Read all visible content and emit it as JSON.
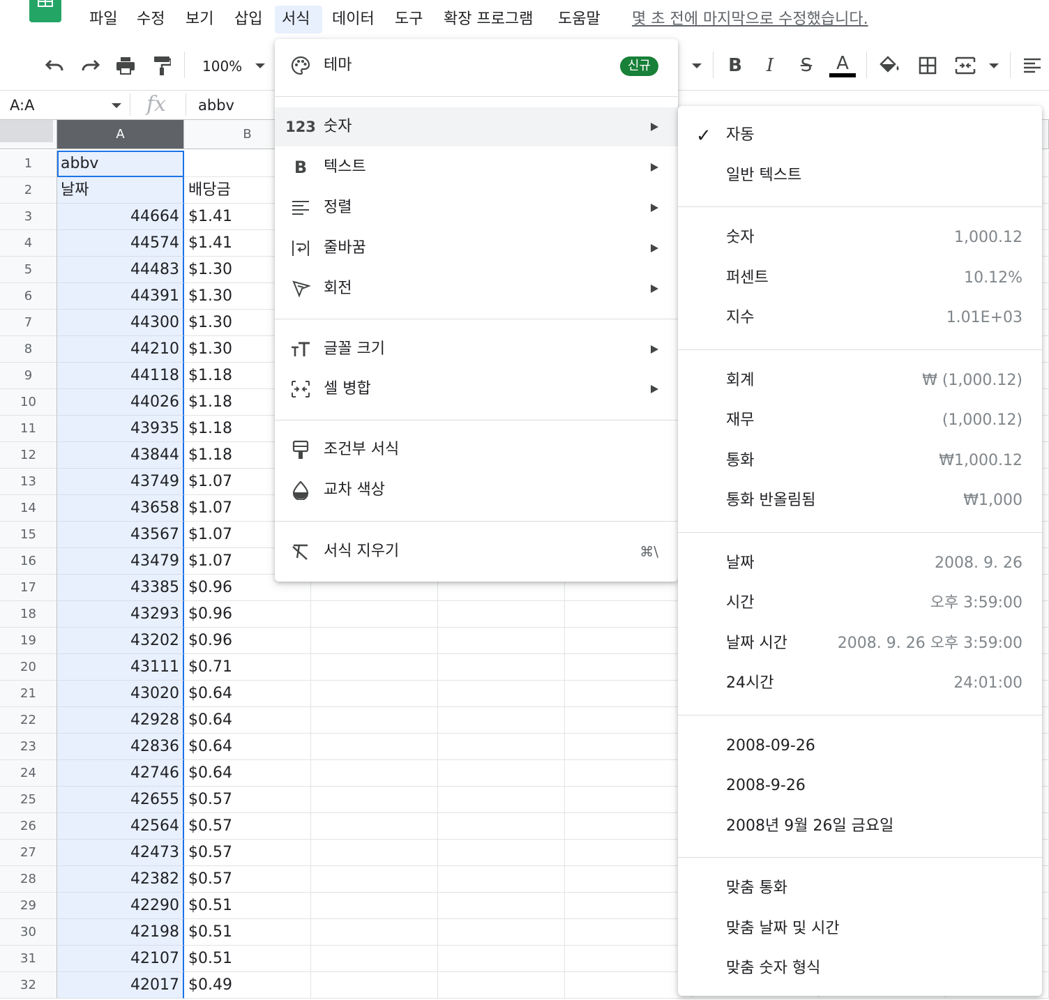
{
  "menubar": {
    "items": [
      "파일",
      "수정",
      "보기",
      "삽입",
      "서식",
      "데이터",
      "도구",
      "확장 프로그램",
      "도움말"
    ],
    "active": "서식",
    "last_edit": "몇 초 전에 마지막으로 수정했습니다."
  },
  "toolbar": {
    "zoom": "100%",
    "icons": [
      "undo-icon",
      "redo-icon",
      "print-icon",
      "paint-format-icon",
      "zoom-select",
      "bold-icon",
      "italic-icon",
      "strikethrough-icon",
      "text-color-icon",
      "fill-color-icon",
      "borders-icon",
      "merge-cells-icon",
      "horizontal-align-icon"
    ],
    "text_color": "#000000"
  },
  "formula_bar": {
    "name_box": "A:A",
    "fx": "fx",
    "value": "abbv"
  },
  "sheet": {
    "columns": [
      "A",
      "B"
    ],
    "selected_column": "A",
    "rows": [
      {
        "n": "1",
        "a": "abbv",
        "b": ""
      },
      {
        "n": "2",
        "a": "날짜",
        "b": "배당금"
      },
      {
        "n": "3",
        "a": "44664",
        "b": "$1.41"
      },
      {
        "n": "4",
        "a": "44574",
        "b": "$1.41"
      },
      {
        "n": "5",
        "a": "44483",
        "b": "$1.30"
      },
      {
        "n": "6",
        "a": "44391",
        "b": "$1.30"
      },
      {
        "n": "7",
        "a": "44300",
        "b": "$1.30"
      },
      {
        "n": "8",
        "a": "44210",
        "b": "$1.30"
      },
      {
        "n": "9",
        "a": "44118",
        "b": "$1.18"
      },
      {
        "n": "10",
        "a": "44026",
        "b": "$1.18"
      },
      {
        "n": "11",
        "a": "43935",
        "b": "$1.18"
      },
      {
        "n": "12",
        "a": "43844",
        "b": "$1.18"
      },
      {
        "n": "13",
        "a": "43749",
        "b": "$1.07"
      },
      {
        "n": "14",
        "a": "43658",
        "b": "$1.07"
      },
      {
        "n": "15",
        "a": "43567",
        "b": "$1.07"
      },
      {
        "n": "16",
        "a": "43479",
        "b": "$1.07"
      },
      {
        "n": "17",
        "a": "43385",
        "b": "$0.96"
      },
      {
        "n": "18",
        "a": "43293",
        "b": "$0.96"
      },
      {
        "n": "19",
        "a": "43202",
        "b": "$0.96"
      },
      {
        "n": "20",
        "a": "43111",
        "b": "$0.71"
      },
      {
        "n": "21",
        "a": "43020",
        "b": "$0.64"
      },
      {
        "n": "22",
        "a": "42928",
        "b": "$0.64"
      },
      {
        "n": "23",
        "a": "42836",
        "b": "$0.64"
      },
      {
        "n": "24",
        "a": "42746",
        "b": "$0.64"
      },
      {
        "n": "25",
        "a": "42655",
        "b": "$0.57"
      },
      {
        "n": "26",
        "a": "42564",
        "b": "$0.57"
      },
      {
        "n": "27",
        "a": "42473",
        "b": "$0.57"
      },
      {
        "n": "28",
        "a": "42382",
        "b": "$0.57"
      },
      {
        "n": "29",
        "a": "42290",
        "b": "$0.51"
      },
      {
        "n": "30",
        "a": "42198",
        "b": "$0.51"
      },
      {
        "n": "31",
        "a": "42107",
        "b": "$0.51"
      },
      {
        "n": "32",
        "a": "42017",
        "b": "$0.49"
      }
    ]
  },
  "format_menu": {
    "theme": {
      "label": "테마",
      "badge": "신규"
    },
    "number": {
      "icon_text": "123",
      "label": "숫자"
    },
    "text": {
      "icon_text": "B",
      "label": "텍스트"
    },
    "align": {
      "label": "정렬"
    },
    "wrap": {
      "label": "줄바꿈"
    },
    "rotate": {
      "label": "회전"
    },
    "font_size": {
      "label": "글꼴 크기"
    },
    "merge": {
      "label": "셀 병합"
    },
    "conditional": {
      "label": "조건부 서식"
    },
    "alternating": {
      "label": "교차 색상"
    },
    "clear": {
      "label": "서식 지우기",
      "shortcut": "⌘\\"
    }
  },
  "number_submenu": {
    "groups": [
      [
        {
          "label": "자동",
          "checked": true,
          "sample": ""
        },
        {
          "label": "일반 텍스트",
          "sample": ""
        }
      ],
      [
        {
          "label": "숫자",
          "sample": "1,000.12"
        },
        {
          "label": "퍼센트",
          "sample": "10.12%"
        },
        {
          "label": "지수",
          "sample": "1.01E+03"
        }
      ],
      [
        {
          "label": "회계",
          "sample": "₩ (1,000.12)"
        },
        {
          "label": "재무",
          "sample": "(1,000.12)"
        },
        {
          "label": "통화",
          "sample": "₩1,000.12"
        },
        {
          "label": "통화 반올림됨",
          "sample": "₩1,000"
        }
      ],
      [
        {
          "label": "날짜",
          "sample": "2008. 9. 26"
        },
        {
          "label": "시간",
          "sample": "오후 3:59:00"
        },
        {
          "label": "날짜 시간",
          "sample": "2008. 9. 26 오후 3:59:00"
        },
        {
          "label": "24시간",
          "sample": "24:01:00"
        }
      ],
      [
        {
          "label": "2008-09-26",
          "sample": ""
        },
        {
          "label": "2008-9-26",
          "sample": ""
        },
        {
          "label": "2008년 9월 26일 금요일",
          "sample": ""
        }
      ],
      [
        {
          "label": "맞춤 통화",
          "sample": ""
        },
        {
          "label": "맞춤 날짜 및 시간",
          "sample": ""
        },
        {
          "label": "맞춤 숫자 형식",
          "sample": ""
        }
      ]
    ]
  },
  "colors": {
    "brand_green": "#23a566",
    "selection_fill": "#e8f0fe",
    "selection_border": "#1a73e8",
    "badge_green": "#188038"
  }
}
